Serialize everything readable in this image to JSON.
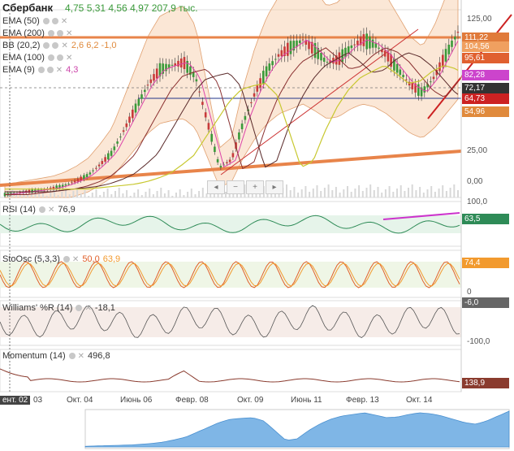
{
  "header": {
    "title": "Сбербанк",
    "quote": "4,75  5,31  4,56  4,97  207,9 тыс."
  },
  "legend": [
    {
      "label": "EMA (50)",
      "value": "",
      "color": "#333333"
    },
    {
      "label": "EMA (200)",
      "value": "",
      "color": "#333333"
    },
    {
      "label": "BB (20,2)",
      "value": "2,6  6,2  -1,0",
      "color": "#e08a3c"
    },
    {
      "label": "EMA (100)",
      "value": "",
      "color": "#333333"
    },
    {
      "label": "EMA (9)",
      "value": "4,3",
      "color": "#cc44aa"
    }
  ],
  "panes": {
    "rsi": {
      "label": "RSI (14)",
      "value": "76,9",
      "tag": "63,5",
      "tag_color": "#2e8b57"
    },
    "stoch": {
      "label": "StoOsc (5,3,3)",
      "value1": "50,0",
      "value2": "63,9",
      "tag1": "74,4",
      "tag2": "",
      "tag1_color": "#f29a2e"
    },
    "williams": {
      "label": "Williams' %R (14)",
      "value": "-18,1",
      "tag": "-6,0",
      "tag_color": "#666666"
    },
    "momentum": {
      "label": "Momentum (14)",
      "value": "496,8",
      "tag": "138,9",
      "tag_color": "#8a3b2e"
    }
  },
  "axis": {
    "price_ticks": [
      "125,00",
      "25,00",
      "0,00",
      "100,0"
    ],
    "rsi_ticks": [],
    "stoch_ticks": [
      "0"
    ],
    "williams_ticks": [
      "-100,0"
    ],
    "date_labels": [
      "ент. 02",
      "03",
      "Окт. 04",
      "Июнь 06",
      "Февр. 08",
      "Окт. 09",
      "Июнь 11",
      "Февр. 13",
      "Окт. 14"
    ]
  },
  "price_tags": [
    {
      "text": "111,22",
      "color": "#e07a3a"
    },
    {
      "text": "104,56",
      "color": "#f0a060"
    },
    {
      "text": "95,61",
      "color": "#e06030"
    },
    {
      "text": "82,28",
      "color": "#cc44cc"
    },
    {
      "text": "72,17",
      "color": "#333333"
    },
    {
      "text": "64,73",
      "color": "#cc2222"
    },
    {
      "text": "54,96",
      "color": "#e08a3c"
    }
  ],
  "nav": {
    "left": "◂",
    "minus": "−",
    "plus": "+",
    "right": "▸"
  },
  "colors": {
    "bull": "#3a9a3a",
    "bear": "#c83a3a",
    "band": "#f7c9a4",
    "ema": "#8a4a3a",
    "level": "#e8844a"
  },
  "chart_data": {
    "type": "line",
    "series": [
      {
        "name": "Сбербанк",
        "values": [
          2,
          3,
          4,
          5,
          6,
          8,
          11,
          15,
          22,
          30,
          45,
          60,
          75,
          85,
          88,
          90,
          80,
          50,
          20,
          25,
          50,
          70,
          85,
          95,
          100,
          105,
          98,
          90,
          92,
          100,
          105,
          102,
          95,
          85,
          75,
          70,
          80,
          95,
          110
        ]
      }
    ],
    "ylim": [
      0,
      125
    ]
  }
}
